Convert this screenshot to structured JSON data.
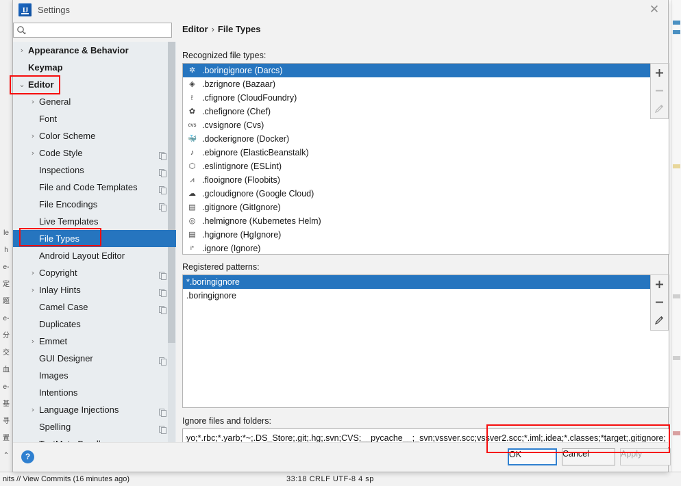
{
  "background": {
    "left_strip_glyphs": [
      "le",
      "h",
      "e-",
      "定",
      "题",
      "e-",
      "分",
      "交",
      "血",
      "e-",
      "基",
      "寻",
      "置",
      "⌃"
    ],
    "status_left": "nits // View Commits (16 minutes ago)",
    "status_right": "33:18   CRLF   UTF-8   4 sp"
  },
  "dialog": {
    "title": "Settings",
    "logo_text": "IJ",
    "close_icon": "✕"
  },
  "search": {
    "value": "",
    "placeholder": ""
  },
  "sidebar": {
    "items": [
      {
        "label": "Appearance & Behavior",
        "level": 0,
        "arrow": "collapsed",
        "copy": false,
        "selected": false
      },
      {
        "label": "Keymap",
        "level": 0,
        "arrow": "none",
        "copy": false,
        "selected": false
      },
      {
        "label": "Editor",
        "level": 0,
        "arrow": "expanded",
        "copy": false,
        "selected": false
      },
      {
        "label": "General",
        "level": 1,
        "arrow": "collapsed",
        "copy": false,
        "selected": false
      },
      {
        "label": "Font",
        "level": 1,
        "arrow": "none",
        "copy": false,
        "selected": false
      },
      {
        "label": "Color Scheme",
        "level": 1,
        "arrow": "collapsed",
        "copy": false,
        "selected": false
      },
      {
        "label": "Code Style",
        "level": 1,
        "arrow": "collapsed",
        "copy": true,
        "selected": false
      },
      {
        "label": "Inspections",
        "level": 1,
        "arrow": "none",
        "copy": true,
        "selected": false
      },
      {
        "label": "File and Code Templates",
        "level": 1,
        "arrow": "none",
        "copy": true,
        "selected": false
      },
      {
        "label": "File Encodings",
        "level": 1,
        "arrow": "none",
        "copy": true,
        "selected": false
      },
      {
        "label": "Live Templates",
        "level": 1,
        "arrow": "none",
        "copy": false,
        "selected": false
      },
      {
        "label": "File Types",
        "level": 1,
        "arrow": "none",
        "copy": false,
        "selected": true
      },
      {
        "label": "Android Layout Editor",
        "level": 1,
        "arrow": "none",
        "copy": false,
        "selected": false
      },
      {
        "label": "Copyright",
        "level": 1,
        "arrow": "collapsed",
        "copy": true,
        "selected": false
      },
      {
        "label": "Inlay Hints",
        "level": 1,
        "arrow": "collapsed",
        "copy": true,
        "selected": false
      },
      {
        "label": "Camel Case",
        "level": 1,
        "arrow": "none",
        "copy": true,
        "selected": false
      },
      {
        "label": "Duplicates",
        "level": 1,
        "arrow": "none",
        "copy": false,
        "selected": false
      },
      {
        "label": "Emmet",
        "level": 1,
        "arrow": "collapsed",
        "copy": false,
        "selected": false
      },
      {
        "label": "GUI Designer",
        "level": 1,
        "arrow": "none",
        "copy": true,
        "selected": false
      },
      {
        "label": "Images",
        "level": 1,
        "arrow": "none",
        "copy": false,
        "selected": false
      },
      {
        "label": "Intentions",
        "level": 1,
        "arrow": "none",
        "copy": false,
        "selected": false
      },
      {
        "label": "Language Injections",
        "level": 1,
        "arrow": "collapsed",
        "copy": true,
        "selected": false
      },
      {
        "label": "Spelling",
        "level": 1,
        "arrow": "none",
        "copy": true,
        "selected": false
      },
      {
        "label": "TextMate Bundles",
        "level": 1,
        "arrow": "none",
        "copy": false,
        "selected": false
      }
    ]
  },
  "breadcrumb": {
    "parent": "Editor",
    "separator": "›",
    "current": "File Types"
  },
  "main": {
    "recognized_label": "Recognized file types:",
    "registered_label": "Registered patterns:",
    "ignore_label": "Ignore files and folders:",
    "recognized_file_types": [
      {
        "name": ".boringignore (Darcs)",
        "icon": "darcs-icon",
        "glyph": "✲",
        "selected": true
      },
      {
        "name": ".bzrignore (Bazaar)",
        "icon": "bazaar-icon",
        "glyph": "◈",
        "selected": false
      },
      {
        "name": ".cfignore (CloudFoundry)",
        "icon": "cloudfoundry-icon",
        "glyph": "♇",
        "selected": false
      },
      {
        "name": ".chefignore (Chef)",
        "icon": "chef-icon",
        "glyph": "✿",
        "selected": false
      },
      {
        "name": ".cvsignore (Cvs)",
        "icon": "cvs-icon",
        "glyph": "cvs",
        "selected": false
      },
      {
        "name": ".dockerignore (Docker)",
        "icon": "docker-icon",
        "glyph": "🐳",
        "selected": false
      },
      {
        "name": ".ebignore (ElasticBeanstalk)",
        "icon": "elasticbeanstalk-icon",
        "glyph": "♪",
        "selected": false
      },
      {
        "name": ".eslintignore (ESLint)",
        "icon": "eslint-icon",
        "glyph": "⬡",
        "selected": false
      },
      {
        "name": ".flooignore (Floobits)",
        "icon": "floobits-icon",
        "glyph": "⩘",
        "selected": false
      },
      {
        "name": ".gcloudignore (Google Cloud)",
        "icon": "google-cloud-icon",
        "glyph": "☁",
        "selected": false
      },
      {
        "name": ".gitignore (GitIgnore)",
        "icon": "gitignore-icon",
        "glyph": "▤",
        "selected": false
      },
      {
        "name": ".helmignore (Kubernetes Helm)",
        "icon": "helm-icon",
        "glyph": "◎",
        "selected": false
      },
      {
        "name": ".hgignore (HgIgnore)",
        "icon": "hgignore-icon",
        "glyph": "▤",
        "selected": false
      },
      {
        "name": ".ignore (Ignore)",
        "icon": "ignore-icon",
        "glyph": "i*",
        "selected": false
      }
    ],
    "registered_patterns": [
      {
        "pattern": "*.boringignore",
        "selected": true
      },
      {
        "pattern": ".boringignore",
        "selected": false
      }
    ],
    "ignore_files_value": "pyo;*.rbc;*.yarb;*~;.DS_Store;.git;.hg;.svn;CVS;__pycache__;_svn;vssver.scc;vssver2.scc;*.iml;.idea;*.classes;*target;.gitignore;",
    "list_toolbar_top": {
      "add": "+",
      "remove": "−",
      "edit": "pencil-icon"
    },
    "list_toolbar_bottom": {
      "add": "+",
      "remove": "−",
      "edit": "pencil-icon"
    }
  },
  "footer": {
    "help_label": "?",
    "ok_label": "OK",
    "cancel_label": "Cancel",
    "apply_label": "Apply"
  },
  "colors": {
    "selection_blue": "#2675bf",
    "annotation_red": "#f60d0d",
    "accent_blue": "#2f80d0",
    "sidebar_bg": "#e9edf0",
    "dialog_bg": "#f2f2f2"
  }
}
